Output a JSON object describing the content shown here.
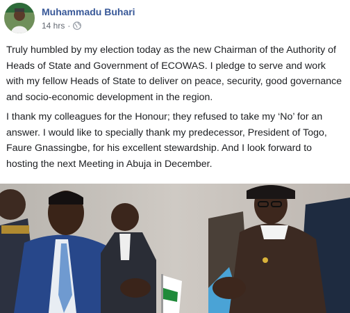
{
  "post": {
    "author_name": "Muhammadu Buhari",
    "timestamp": "14 hrs",
    "separator": "·",
    "privacy_icon": "globe-icon",
    "paragraphs": [
      "Truly humbled by my election today as the new Chairman of the Authority of Heads of State and Government of ECOWAS. I pledge to serve and work with my fellow Heads of State to deliver on peace, security, good governance and socio-economic development in the region.",
      "I thank my colleagues for the Honour; they refused to take my ‘No’ for an answer. I would like to specially thank my predecessor, President of Togo, Faure Gnassingbe, for his excellent stewardship. And I look forward to hosting the next Meeting in Abuja in December."
    ]
  },
  "colors": {
    "name_link": "#385898",
    "meta_text": "#616770",
    "body_text": "#1c1e21"
  }
}
